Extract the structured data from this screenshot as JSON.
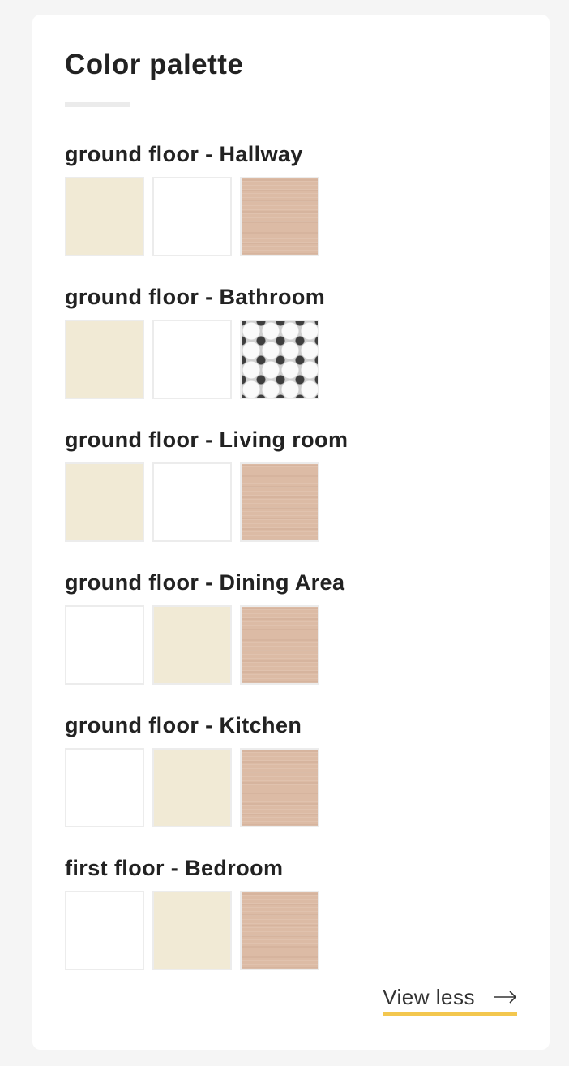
{
  "title": "Color palette",
  "rooms": [
    {
      "name": "ground floor - Hallway",
      "swatches": [
        "cream",
        "white",
        "wood"
      ]
    },
    {
      "name": "ground floor - Bathroom",
      "swatches": [
        "cream",
        "white",
        "tile"
      ]
    },
    {
      "name": "ground floor - Living room",
      "swatches": [
        "cream",
        "white",
        "wood"
      ]
    },
    {
      "name": "ground floor - Dining Area",
      "swatches": [
        "white",
        "cream",
        "wood"
      ]
    },
    {
      "name": "ground floor - Kitchen",
      "swatches": [
        "white",
        "cream",
        "wood"
      ]
    },
    {
      "name": "first floor - Bedroom",
      "swatches": [
        "white",
        "cream",
        "wood"
      ]
    }
  ],
  "colors": {
    "cream": "#f1ead5",
    "white": "#ffffff",
    "wood": "#dcbba5",
    "accent_underline": "#f3c74f"
  },
  "view_less": {
    "label": "View less",
    "icon": "arrow-right-icon"
  }
}
